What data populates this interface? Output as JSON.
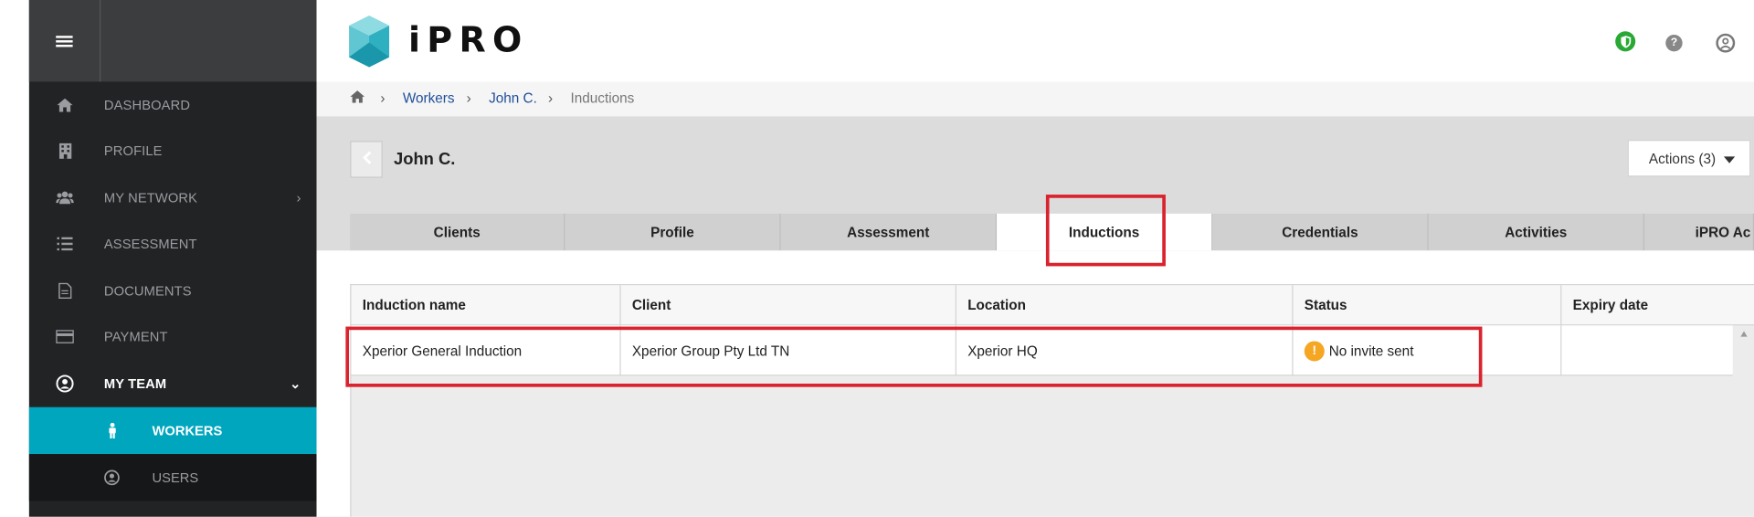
{
  "brand": {
    "name": "iPRO"
  },
  "sidebar": {
    "items": [
      {
        "label": "DASHBOARD",
        "icon": "home-icon"
      },
      {
        "label": "PROFILE",
        "icon": "building-icon"
      },
      {
        "label": "MY NETWORK",
        "icon": "users-icon",
        "has_children": true
      },
      {
        "label": "ASSESSMENT",
        "icon": "list-icon"
      },
      {
        "label": "DOCUMENTS",
        "icon": "document-icon"
      },
      {
        "label": "PAYMENT",
        "icon": "credit-card-icon"
      },
      {
        "label": "MY TEAM",
        "icon": "user-circle-icon",
        "expanded": true
      }
    ],
    "subitems": [
      {
        "label": "WORKERS",
        "icon": "person-icon",
        "active": true
      },
      {
        "label": "USERS",
        "icon": "user-circle-icon"
      }
    ],
    "active_color": "#00a6be"
  },
  "breadcrumb": {
    "home_icon": "home-icon",
    "items": [
      "Workers",
      "John C.",
      "Inductions"
    ]
  },
  "worker": {
    "name": "John C."
  },
  "actions": {
    "label": "Actions (3)"
  },
  "tabs": [
    {
      "label": "Clients"
    },
    {
      "label": "Profile"
    },
    {
      "label": "Assessment"
    },
    {
      "label": "Inductions",
      "active": true
    },
    {
      "label": "Credentials"
    },
    {
      "label": "Activities"
    },
    {
      "label": "iPRO Ac"
    }
  ],
  "table": {
    "columns": [
      "Induction name",
      "Client",
      "Location",
      "Status",
      "Expiry date"
    ],
    "rows": [
      {
        "induction_name": "Xperior General Induction",
        "client": "Xperior Group Pty Ltd TN",
        "location": "Xperior HQ",
        "status": "No invite sent",
        "status_icon": "warning-icon",
        "expiry_date": ""
      }
    ]
  },
  "highlight_color": "#d9232e"
}
